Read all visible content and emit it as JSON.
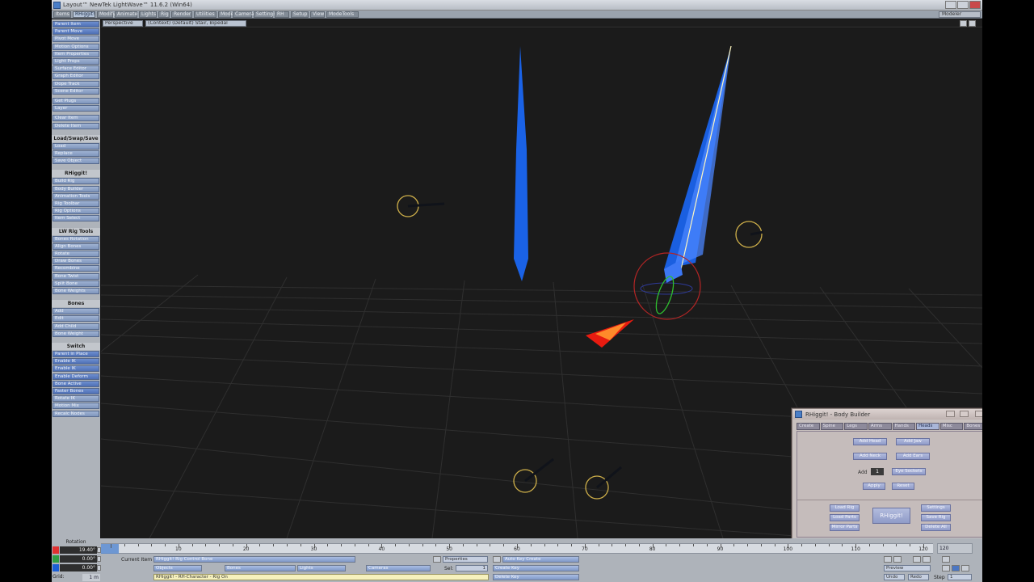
{
  "window": {
    "title": "Layout™ NewTek LightWave™ 11.6.2 (Win64)",
    "controls": [
      "minimize",
      "maximize",
      "close"
    ]
  },
  "top_tabs": [
    "Items",
    "RHiggit!",
    "Modify",
    "Animate",
    "Lights",
    "Rig",
    "Render",
    "Utilities",
    "Model",
    "Camera",
    "Settings",
    "RH",
    "Setup",
    "View",
    "ModeTools"
  ],
  "top_right": "Modeler",
  "viewport_header": {
    "view_select": "Perspective",
    "context_select": "(Context) (Default) Stair, Bipedal"
  },
  "sidebar": {
    "top_items": [
      "Parent Item",
      "Parent Move",
      "Pivot Move",
      "Motion Options",
      "Item Properties",
      "Light Props",
      "Surface Editor",
      "Graph Editor",
      "Dope Track",
      "Scene Editor",
      "Get Plugs",
      "Layer",
      "Clear Item",
      "Delete Item"
    ],
    "sections": [
      {
        "title": "Load/Swap/Save",
        "items": [
          "Load",
          "Replace",
          "Save Object"
        ]
      },
      {
        "title": "RHiggit!",
        "items": [
          "Build Rig",
          "Body Builder",
          "Animation Tools",
          "Rig Toolbar",
          "Rig Options",
          "Item Select"
        ]
      },
      {
        "title": "LW Rig Tools",
        "items": [
          "Bones Rotation",
          "Align Bones",
          "Rotate",
          "Draw Bones",
          "Recombine",
          "Bone Twist",
          "Split Bone",
          "Bone Weights"
        ]
      },
      {
        "title": "Bones",
        "items": [
          "Add",
          "Edit",
          "Add Child",
          "Bone Weight"
        ]
      },
      {
        "title": "Switch",
        "items": [
          "Parent in Place",
          "Enable IK",
          "Enable IK",
          "Enable Deform",
          "Bone Active",
          "Faster Bones",
          "Rotate IK",
          "Motion Mix",
          "Recalc Nodes"
        ]
      }
    ]
  },
  "rotation": {
    "label": "Rotation",
    "h": "19.40°",
    "p": "0.00°",
    "b": "0.00°",
    "colors": {
      "h": "#e03131",
      "p": "#2f9e44",
      "b": "#1c5fd6"
    }
  },
  "grid": {
    "label": "Grid:",
    "value": "1 m"
  },
  "timeline": {
    "start": "0",
    "current_marker": "0",
    "ticks": [
      "10",
      "20",
      "30",
      "40",
      "50",
      "60",
      "70",
      "80",
      "90",
      "100",
      "110",
      "120"
    ],
    "end": "120"
  },
  "bottom_bar": {
    "current_item_label": "Current Item",
    "current_item": "RHiggit! Rig Control Bone",
    "objects_tab": "Objects",
    "bones_tab": "Bones",
    "lights_tab": "Lights",
    "cameras_tab": "Cameras",
    "status_text": "RHiggit! - RH-Character - Rig On",
    "sel_label": "Sel:",
    "sel_value": "1",
    "properties_btn": "Properties",
    "auto_key": "Auto Key Create",
    "create_key": "Create Key",
    "delete_key": "Delete Key",
    "preview": "Preview",
    "step_label": "Step",
    "step_value": "1",
    "undo": "Undo",
    "redo": "Redo"
  },
  "panel": {
    "title": "RHiggit! - Body Builder",
    "tabs": [
      "Create",
      "Spine",
      "Legs",
      "Arms",
      "Hands",
      "Heads",
      "Misc",
      "Bones"
    ],
    "active_tab": "Heads",
    "row1": [
      "Add Head",
      "Add Jaw"
    ],
    "row2": [
      "Add Neck",
      "Add Ears"
    ],
    "add_label": "Add",
    "add_value": "1",
    "add_button": "Eye Sockets",
    "row4": [
      "Apply",
      "Reset"
    ],
    "bottom_left": [
      "Load Rig",
      "Load Parts",
      "Mirror Parts"
    ],
    "bottom_center": "RHiggit!",
    "bottom_right": [
      "Settings",
      "Save Rig",
      "Delete All"
    ]
  }
}
